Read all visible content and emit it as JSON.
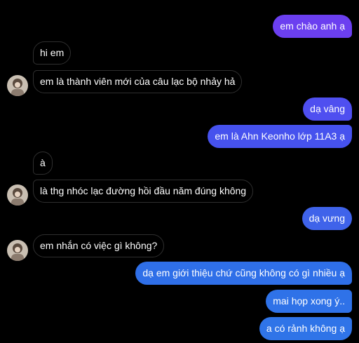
{
  "messages": [
    {
      "side": "outgoing",
      "text": "em chào anh ạ",
      "color": "#6b3ff0"
    },
    {
      "side": "incoming",
      "text": "hi em"
    },
    {
      "side": "incoming",
      "text": "em là thành viên mới của câu lạc bộ nhảy hả"
    },
    {
      "side": "outgoing",
      "text": "dạ vâng",
      "color": "#4f4ff0"
    },
    {
      "side": "outgoing",
      "text": "em là Ahn Keonho lớp 11A3 ạ",
      "color": "#4652ee"
    },
    {
      "side": "incoming",
      "text": "à"
    },
    {
      "side": "incoming",
      "text": "là thg nhóc lạc đường hồi đầu năm đúng không"
    },
    {
      "side": "outgoing",
      "text": "dạ vưng",
      "color": "#3f63ea"
    },
    {
      "side": "incoming",
      "text": "em nhắn có việc gì không?"
    },
    {
      "side": "outgoing",
      "text": "dạ em giới thiệu chứ cũng không có gì nhiều ạ",
      "color": "#2f6fe8"
    },
    {
      "side": "outgoing",
      "text": "mai họp xong ý..",
      "color": "#2f72e8"
    },
    {
      "side": "outgoing",
      "text": "a có rảnh không ạ",
      "color": "#2f74e8"
    }
  ],
  "avatar": {
    "icon": "user-avatar-icon"
  }
}
